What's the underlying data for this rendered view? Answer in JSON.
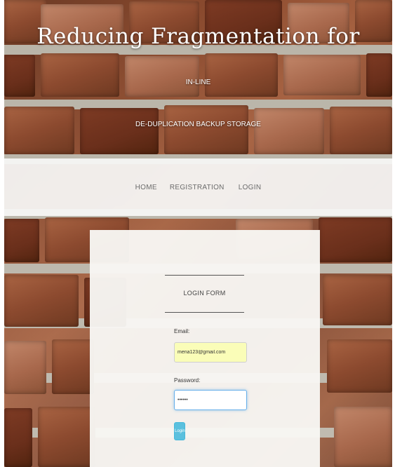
{
  "header": {
    "title": "Reducing Fragmentation for",
    "subtitle_line1": "IN-LINE",
    "subtitle_line2": "DE-DUPLICATION BACKUP STORAGE"
  },
  "nav": {
    "items": [
      {
        "label": "HOME"
      },
      {
        "label": "REGISTRATION"
      },
      {
        "label": "LOGIN"
      }
    ]
  },
  "login_form": {
    "title": "LOGIN FORM",
    "email_label": "Email:",
    "email_value": "mena123@gmail.com",
    "password_label": "Password:",
    "password_value": "••••••",
    "button_label": "Login"
  },
  "colors": {
    "button_accent": "#5bc0de",
    "email_field_bg": "#fafdb8",
    "focus_border": "#66afe9"
  }
}
